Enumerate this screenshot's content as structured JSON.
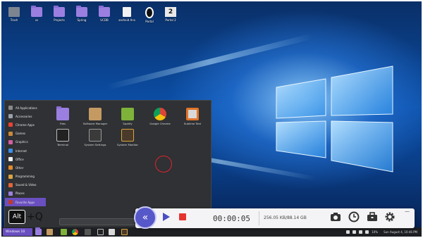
{
  "desktop_icons": [
    {
      "label": "Trash",
      "icon": "trash-icon"
    },
    {
      "label": "vs",
      "icon": "folder-icon"
    },
    {
      "label": "Projects",
      "icon": "folder-icon"
    },
    {
      "label": "Spring",
      "icon": "folder-icon"
    },
    {
      "label": "UCDB",
      "icon": "folder-icon"
    },
    {
      "label": "android Ans",
      "icon": "document-icon"
    },
    {
      "label": "Portal",
      "icon": "portal-icon"
    },
    {
      "label": "Portal 2",
      "icon": "portal-2-icon"
    }
  ],
  "menu": {
    "categories": [
      "All Applications",
      "Accessories",
      "Chrome Apps",
      "Games",
      "Graphics",
      "Internet",
      "Office",
      "Other",
      "Programming",
      "Sound & Video",
      "Places",
      "Favorite Apps"
    ],
    "active_category": "Favorite Apps",
    "apps": [
      {
        "label": "Files",
        "icon": "files-icon"
      },
      {
        "label": "Software Manager",
        "icon": "software-manager-icon"
      },
      {
        "label": "Spotify",
        "icon": "spotify-icon"
      },
      {
        "label": "Google Chrome",
        "icon": "chrome-icon"
      },
      {
        "label": "Sublime Text",
        "icon": "sublime-text-icon"
      },
      {
        "label": "Terminal",
        "icon": "terminal-icon"
      },
      {
        "label": "System Settings",
        "icon": "system-settings-icon"
      },
      {
        "label": "System Monitor",
        "icon": "system-monitor-icon"
      }
    ]
  },
  "keys": {
    "alt": "Alt",
    "plus_q": "+Q"
  },
  "taskbar": {
    "start_label": "Windows 10",
    "clock": "Sun August 4, 10:46 PM",
    "volume": "10%"
  },
  "recorder": {
    "timer": "00:00:05",
    "rate": "256.05 KB/88.14 GB",
    "colors": {
      "accent": "#5657c9",
      "stop": "#e5342f"
    }
  }
}
